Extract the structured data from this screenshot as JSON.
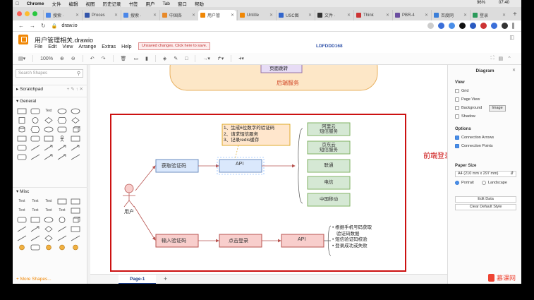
{
  "menubar": {
    "apple": "",
    "items": [
      "Chrome",
      "文件",
      "编辑",
      "视图",
      "历史记录",
      "书签",
      "用户",
      "Tab",
      "窗口",
      "帮助"
    ],
    "battery": "96%",
    "time": "07:40"
  },
  "browser_tabs": [
    {
      "label": "搜索 ·",
      "color": "#4a86e8"
    },
    {
      "label": "Proces",
      "color": "#3355aa"
    },
    {
      "label": "搜索 ·",
      "color": "#4a86e8"
    },
    {
      "label": "中国各",
      "color": "#e88a2a"
    },
    {
      "label": "用户管",
      "color": "#f08705",
      "active": true
    },
    {
      "label": "Untitle",
      "color": "#f08705"
    },
    {
      "label": "USC图",
      "color": "#3366cc"
    },
    {
      "label": "文件 ·",
      "color": "#333333"
    },
    {
      "label": "Think",
      "color": "#cc3333"
    },
    {
      "label": "PBR-4",
      "color": "#6b4ea0"
    },
    {
      "label": "百度网",
      "color": "#3a7ed8"
    },
    {
      "label": "登录",
      "color": "#2a9a5a"
    }
  ],
  "address": {
    "url": "draw.io"
  },
  "app": {
    "title": "用户管理相关.drawio",
    "menus": [
      "File",
      "Edit",
      "View",
      "Arrange",
      "Extras",
      "Help"
    ],
    "unsaved": "Unsaved changes. Click here to save.",
    "doc_id": "LDFDDD168"
  },
  "toolbar": {
    "zoom": "100%"
  },
  "sidebar": {
    "search_placeholder": "Search Shapes",
    "scratchpad": "Scratchpad",
    "general": "General",
    "misc": "Misc",
    "more_shapes": "+ More Shapes..."
  },
  "diagram": {
    "backend_top_box": "页面跳转",
    "backend_label": "后端服务",
    "title": "前端登录流程",
    "user_label": "用户",
    "get_code": "获取验证码",
    "api1": "API",
    "note_lines": [
      "1、生成6位数字的验证码",
      "2、请求短信服务",
      "3、记录redis缓存"
    ],
    "providers": [
      "阿里云\n短信服务",
      "京东云\n短信服务",
      "联通",
      "电信",
      "中国移动"
    ],
    "input_code": "输入验证码",
    "login": "点击登录",
    "api2": "API",
    "bullets": [
      "根据手机号码获取\n验证码数据",
      "短信验证码校验",
      "登录成功或失败"
    ]
  },
  "rpanel": {
    "title": "Diagram",
    "view": "View",
    "grid": "Grid",
    "page_view": "Page View",
    "background": "Background",
    "image_btn": "Image",
    "shadow": "Shadow",
    "options": "Options",
    "connection_arrows": "Connection Arrows",
    "connection_points": "Connection Points",
    "paper_size": "Paper Size",
    "paper_value": "A4 (210 mm x 297 mm)",
    "portrait": "Portrait",
    "landscape": "Landscape",
    "edit_data": "Edit Data",
    "clear_style": "Clear Default Style"
  },
  "pages": {
    "page1": "Page-1",
    "add": "+"
  },
  "watermark": "慕课网"
}
